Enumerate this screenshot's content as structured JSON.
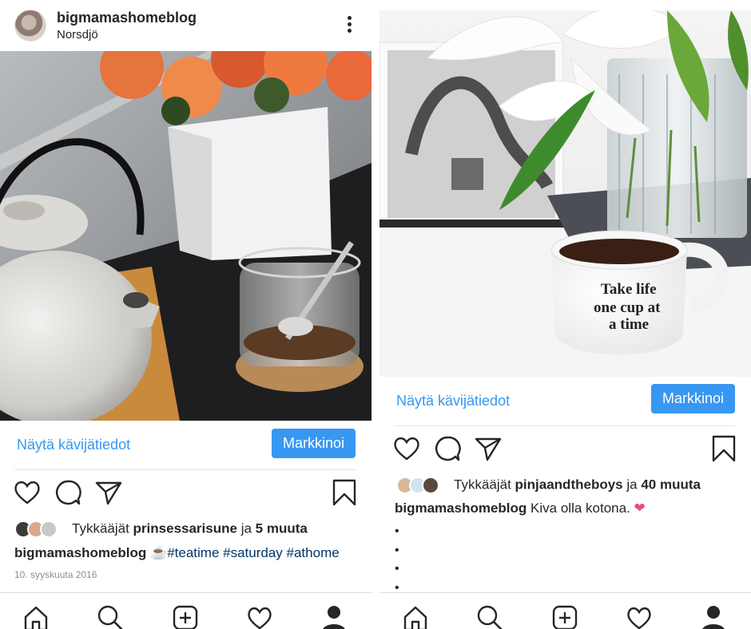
{
  "left_post": {
    "username": "bigmamashomeblog",
    "location": "Norsdjö",
    "cta_link": "Näytä kävijätiedot",
    "cta_button": "Markkinoi",
    "likes_prefix": "Tykkääjät",
    "likes_user": "prinsessarisune",
    "likes_join": "ja",
    "likes_others": "5 muuta",
    "caption_user": "bigmamashomeblog",
    "caption_emoji": "☕",
    "caption_tags": "#teatime #saturday #athome",
    "date": "10. syyskuuta 2016"
  },
  "right_post": {
    "cta_link": "Näytä kävijätiedot",
    "cta_button": "Markkinoi",
    "likes_prefix": "Tykkääjät",
    "likes_user": "pinjaandtheboys",
    "likes_join": "ja",
    "likes_others": "40 muuta",
    "caption_user": "bigmamashomeblog",
    "caption_text": "Kiva olla kotona.",
    "caption_emoji": "❤",
    "bullets": [
      "•",
      "•",
      "•",
      "•"
    ],
    "mug_text": [
      "Take life",
      "one cup at",
      "a time"
    ]
  },
  "icons": {
    "like": "heart-icon",
    "comment": "comment-icon",
    "share": "share-icon",
    "save": "bookmark-icon",
    "nav": [
      "home-icon",
      "search-icon",
      "add-icon",
      "activity-icon",
      "profile-icon"
    ]
  },
  "colors": {
    "accent": "#3897f0",
    "hashtag": "#003569",
    "muted": "#8e8e8e",
    "text": "#262626"
  }
}
